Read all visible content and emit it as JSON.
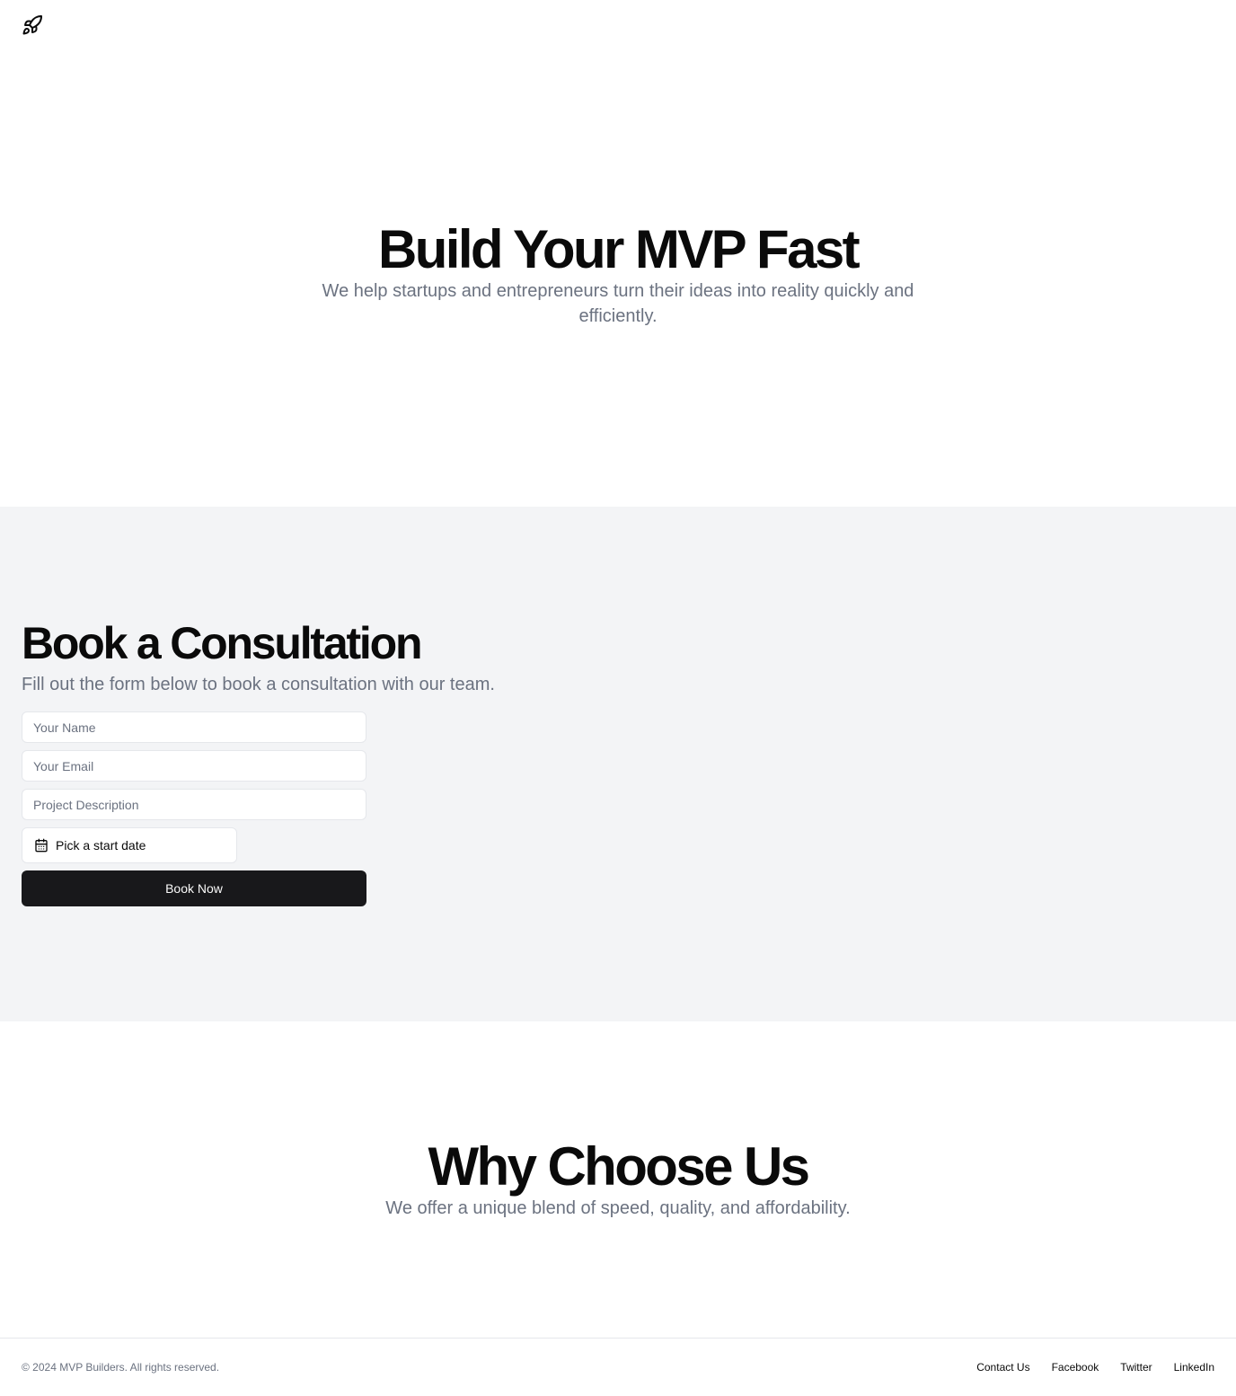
{
  "header": {
    "logo_icon": "rocket-icon"
  },
  "hero": {
    "title": "Build Your MVP Fast",
    "subtitle": "We help startups and entrepreneurs turn their ideas into reality quickly and efficiently."
  },
  "booking": {
    "title": "Book a Consultation",
    "subtitle": "Fill out the form below to book a consultation with our team.",
    "name_placeholder": "Your Name",
    "email_placeholder": "Your Email",
    "description_placeholder": "Project Description",
    "date_label": "Pick a start date",
    "date_icon": "calendar-icon",
    "submit_label": "Book Now"
  },
  "why": {
    "title": "Why Choose Us",
    "subtitle": "We offer a unique blend of speed, quality, and affordability."
  },
  "footer": {
    "copyright": "© 2024 MVP Builders. All rights reserved.",
    "links": [
      "Contact Us",
      "Facebook",
      "Twitter",
      "LinkedIn"
    ]
  },
  "colors": {
    "muted_text": "#6b7280",
    "section_bg": "#f3f4f6",
    "primary_button": "#18181b",
    "border": "#e5e7eb"
  }
}
